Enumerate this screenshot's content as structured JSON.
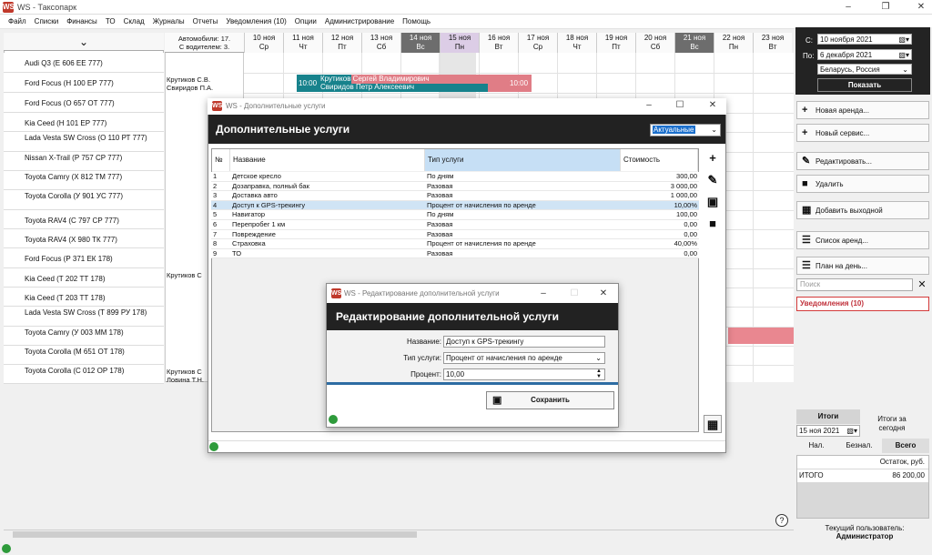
{
  "app": {
    "title": "WS - Таксопарк",
    "logo": "WS"
  },
  "menu": [
    "Файл",
    "Списки",
    "Финансы",
    "ТО",
    "Склад",
    "Журналы",
    "Отчеты",
    "Уведомления (10)",
    "Опции",
    "Администрирование",
    "Помощь"
  ],
  "grid": {
    "autos_label": "Автомобили: 17.",
    "drivers_label": "С водителем: 3.",
    "dates": [
      {
        "d": "10 ноя",
        "w": "Ср"
      },
      {
        "d": "11 ноя",
        "w": "Чт"
      },
      {
        "d": "12 ноя",
        "w": "Пт"
      },
      {
        "d": "13 ноя",
        "w": "Сб"
      },
      {
        "d": "14 ноя",
        "w": "Вс"
      },
      {
        "d": "15 ноя",
        "w": "Пн"
      },
      {
        "d": "16 ноя",
        "w": "Вт"
      },
      {
        "d": "17 ноя",
        "w": "Ср"
      },
      {
        "d": "18 ноя",
        "w": "Чт"
      },
      {
        "d": "19 ноя",
        "w": "Пт"
      },
      {
        "d": "20 ноя",
        "w": "Сб"
      },
      {
        "d": "21 ноя",
        "w": "Вс"
      },
      {
        "d": "22 ноя",
        "w": "Пн"
      },
      {
        "d": "23 ноя",
        "w": "Вт"
      }
    ],
    "cars": [
      "Audi Q3 (Е 606 ЕЕ 777)",
      "Ford Focus (Н 100 ЕР 777)",
      "Ford Focus (О 657 ОТ 777)",
      "Kia Ceed (Н 101 ЕР 777)",
      "Lada Vesta SW Cross (О 110 РТ 777)",
      "Nissan X-Trail (Р 757 СР 777)",
      "Toyota Camry (Х 812 ТМ 777)",
      "Toyota Corolla (У 901 УС 777)",
      "Toyota RAV4 (С 797 СР 777)",
      "Toyota RAV4 (Х 980 ТК 777)",
      "Ford Focus (Р 371 ЕК 178)",
      "Kia Ceed (Т 202 ТТ 178)",
      "Kia Ceed (Т 203 ТТ 178)",
      "Lada Vesta SW Cross (Т 899 РУ 178)",
      "Toyota Camry (У 003 ММ 178)",
      "Toyota Corolla (М 651 ОТ 178)",
      "Toyota Corolla (С 012 ОР 178)"
    ],
    "drivers": [
      {
        "row": 1,
        "text": "Крутиков С.В."
      },
      {
        "row": 1,
        "text2": "Свиридов П.А."
      },
      {
        "row": 11,
        "text": "Крутиков С"
      },
      {
        "row": 16,
        "text": "Крутиков С"
      },
      {
        "row": 16,
        "text2": "Ловина Т.Н."
      }
    ],
    "booking": {
      "time_start": "10:00",
      "time_end": "10:00",
      "line1": "Крутиков Сергей Владимирович",
      "line2": "Свиридов Петр Алексеевич"
    }
  },
  "right": {
    "from_label": "С:",
    "to_label": "По:",
    "from_date": "10 ноября  2021",
    "to_date": "6 декабря  2021",
    "region": "Беларусь, Россия",
    "show": "Показать",
    "actions": [
      "Новая аренда...",
      "Новый сервис...",
      "Редактировать...",
      "Удалить",
      "Добавить выходной",
      "Список аренд...",
      "План на день..."
    ],
    "search_placeholder": "Поиск",
    "notifications": "Уведомления (10)",
    "totals": "Итоги",
    "totals_today": "Итоги за сегодня",
    "totals_date": "15 ноя  2021",
    "pay_tabs": [
      "Нал.",
      "Безнал.",
      "Всего"
    ],
    "table_header": "Остаток, руб.",
    "table_row_label": "ИТОГО",
    "table_row_value": "86 200,00",
    "user_label": "Текущий пользователь:",
    "user": "Администратор",
    "help": "?"
  },
  "dialog1": {
    "title": "WS - Дополнительные услуги",
    "header": "Дополнительные услуги",
    "filter": "Актуальные",
    "columns": [
      "№",
      "Название",
      "Тип услуги",
      "Стоимость"
    ],
    "rows": [
      [
        "1",
        "Детское кресло",
        "По дням",
        "300,00"
      ],
      [
        "2",
        "Дозаправка, полный бак",
        "Разовая",
        "3 000,00"
      ],
      [
        "3",
        "Доставка авто",
        "Разовая",
        "1 000,00"
      ],
      [
        "4",
        "Доступ к GPS-трекингу",
        "Процент от начисления по аренде",
        "10,00%"
      ],
      [
        "5",
        "Навигатор",
        "По дням",
        "100,00"
      ],
      [
        "6",
        "Перепробег 1 км",
        "Разовая",
        "0,00"
      ],
      [
        "7",
        "Повреждение",
        "Разовая",
        "0,00"
      ],
      [
        "8",
        "Страховка",
        "Процент от начисления по аренде",
        "40,00%"
      ],
      [
        "9",
        "ТО",
        "Разовая",
        "0,00"
      ]
    ],
    "selected_row": 3
  },
  "dialog2": {
    "title": "WS - Редактирование дополнительной услуги",
    "header": "Редактирование дополнительной услуги",
    "name_label": "Название:",
    "name_value": "Доступ к GPS-трекингу",
    "type_label": "Тип услуги:",
    "type_value": "Процент от начисления по аренде",
    "percent_label": "Процент:",
    "percent_value": "10,00",
    "save": "Сохранить"
  }
}
